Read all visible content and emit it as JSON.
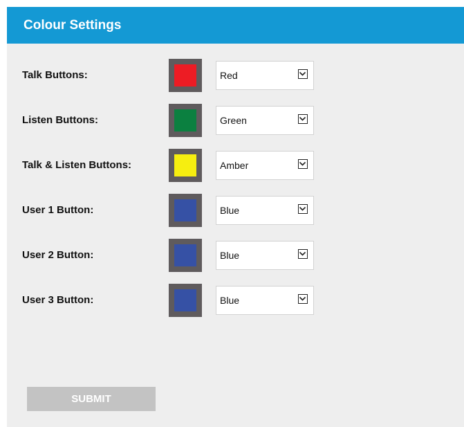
{
  "header": {
    "title": "Colour Settings"
  },
  "settings": [
    {
      "label": "Talk Buttons:",
      "selected": "Red",
      "swatch_color": "#ed1c24"
    },
    {
      "label": "Listen Buttons:",
      "selected": "Green",
      "swatch_color": "#0b8040"
    },
    {
      "label": "Talk & Listen Buttons:",
      "selected": "Amber",
      "swatch_color": "#f6ee10"
    },
    {
      "label": "User 1 Button:",
      "selected": "Blue",
      "swatch_color": "#3651a5"
    },
    {
      "label": "User 2 Button:",
      "selected": "Blue",
      "swatch_color": "#3651a5"
    },
    {
      "label": "User 3 Button:",
      "selected": "Blue",
      "swatch_color": "#3651a5"
    }
  ],
  "icons": {
    "dropdown": "chevron-down-icon"
  },
  "submit": {
    "label": "SUBMIT"
  },
  "colors": {
    "header_bg": "#1499d4",
    "panel_bg": "#eeeeee",
    "swatch_frame": "#5f5b5d",
    "submit_bg": "#c3c3c3"
  }
}
